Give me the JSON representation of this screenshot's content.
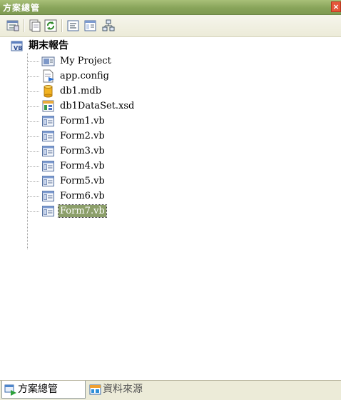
{
  "window": {
    "title": "方案總管",
    "close_glyph": "×"
  },
  "toolbar": {
    "buttons": [
      {
        "icon": "properties-icon"
      },
      {
        "icon": "show-all-files-icon"
      },
      {
        "icon": "refresh-icon"
      },
      {
        "icon": "view-code-icon"
      },
      {
        "icon": "view-designer-icon"
      },
      {
        "icon": "class-diagram-icon"
      }
    ]
  },
  "tree": {
    "root": {
      "label": "期末報告",
      "icon": "vb-project-icon"
    },
    "items": [
      {
        "label": "My Project",
        "icon": "my-project-icon"
      },
      {
        "label": "app.config",
        "icon": "config-file-icon"
      },
      {
        "label": "db1.mdb",
        "icon": "database-icon"
      },
      {
        "label": "db1DataSet.xsd",
        "icon": "dataset-icon"
      },
      {
        "label": "Form1.vb",
        "icon": "form-icon"
      },
      {
        "label": "Form2.vb",
        "icon": "form-icon"
      },
      {
        "label": "Form3.vb",
        "icon": "form-icon"
      },
      {
        "label": "Form4.vb",
        "icon": "form-icon"
      },
      {
        "label": "Form5.vb",
        "icon": "form-icon"
      },
      {
        "label": "Form6.vb",
        "icon": "form-icon"
      },
      {
        "label": "Form7.vb",
        "icon": "form-icon",
        "selected": true
      }
    ]
  },
  "tabs": [
    {
      "label": "方案總管",
      "icon": "solution-explorer-icon",
      "active": true
    },
    {
      "label": "資料來源",
      "icon": "data-sources-icon",
      "active": false
    }
  ],
  "colors": {
    "titlebar": "#88a45a",
    "selection": "#8c9f6a",
    "toolbar": "#ecebd8"
  }
}
